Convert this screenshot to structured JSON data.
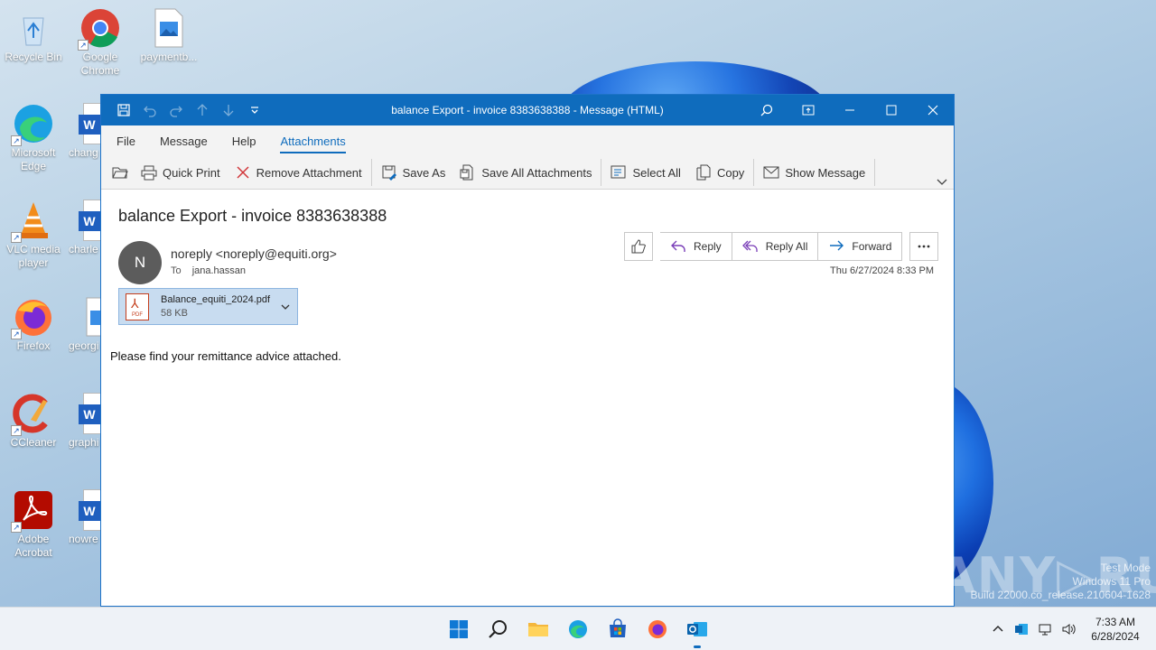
{
  "desktop": {
    "icons": [
      {
        "label": "Recycle Bin",
        "icon": "recycle-bin-icon"
      },
      {
        "label": "Google Chrome",
        "icon": "chrome-icon"
      },
      {
        "label": "paymentb...",
        "icon": "image-file-icon"
      },
      {
        "label": "Microsoft Edge",
        "icon": "edge-icon"
      },
      {
        "label": "chang",
        "icon": "word-doc-icon"
      },
      {
        "label": "VLC media player",
        "icon": "vlc-icon"
      },
      {
        "label": "charle",
        "icon": "word-doc-icon"
      },
      {
        "label": "Firefox",
        "icon": "firefox-icon"
      },
      {
        "label": "georgi",
        "icon": "image-file-icon"
      },
      {
        "label": "CCleaner",
        "icon": "ccleaner-icon"
      },
      {
        "label": "graphi",
        "icon": "word-doc-icon"
      },
      {
        "label": "Adobe Acrobat",
        "icon": "acrobat-icon"
      },
      {
        "label": "nowre",
        "icon": "word-doc-icon"
      }
    ]
  },
  "window": {
    "title": "balance Export - invoice 8383638388  -  Message (HTML)",
    "menu": [
      "File",
      "Message",
      "Help",
      "Attachments"
    ],
    "active_menu": "Attachments",
    "ribbon": {
      "quick_print": "Quick Print",
      "remove_attachment": "Remove Attachment",
      "save_as": "Save As",
      "save_all": "Save All Attachments",
      "select_all": "Select All",
      "copy": "Copy",
      "show_message": "Show Message"
    }
  },
  "message": {
    "subject": "balance Export - invoice 8383638388",
    "avatar_initial": "N",
    "sender": "noreply <noreply@equiti.org>",
    "to_label": "To",
    "to": "jana.hassan",
    "date": "Thu 6/27/2024 8:33 PM",
    "actions": {
      "reply": "Reply",
      "reply_all": "Reply All",
      "forward": "Forward"
    },
    "attachment": {
      "name": "Balance_equiti_2024.pdf",
      "size": "58 KB",
      "type_tag": "PDF"
    },
    "body": "Please find your remittance advice attached."
  },
  "taskbar": {
    "time": "7:33 AM",
    "date": "6/28/2024"
  },
  "watermark": {
    "line1": "Test Mode",
    "line2": "Windows 11 Pro",
    "line3": "Build 22000.co_release.210604-1628",
    "brand": "ANY.RUN"
  },
  "colors": {
    "accent": "#0f6cbd",
    "titlebar": "#0f6cbd",
    "attachment_bg": "#c8dcf0"
  }
}
